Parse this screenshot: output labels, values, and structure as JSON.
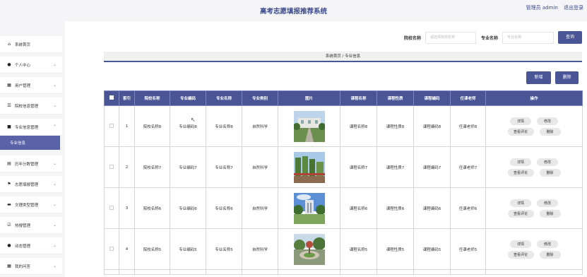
{
  "header": {
    "title": "高考志愿填报推荐系统",
    "user_label": "管理员 admin",
    "logout_label": "退出登录"
  },
  "sidebar": {
    "items": [
      {
        "label": "系统首页",
        "icon": "home-icon",
        "glyph": "⌂",
        "has_chevron": false
      },
      {
        "label": "个人中心",
        "icon": "user-icon",
        "glyph": "●",
        "has_chevron": true
      },
      {
        "label": "用户管理",
        "icon": "grid-icon",
        "glyph": "▦",
        "has_chevron": true
      },
      {
        "label": "院校信息管理",
        "icon": "sliders-icon",
        "glyph": "☰",
        "has_chevron": true
      },
      {
        "label": "专业信息管理",
        "icon": "lock-icon",
        "glyph": "■",
        "has_chevron": true,
        "expanded": true
      },
      {
        "label": "历年分数管理",
        "icon": "list-icon",
        "glyph": "▤",
        "has_chevron": true
      },
      {
        "label": "志愿填报管理",
        "icon": "flag-icon",
        "glyph": "⚑",
        "has_chevron": true
      },
      {
        "label": "文理类型管理",
        "icon": "printer-icon",
        "glyph": "▬",
        "has_chevron": true
      },
      {
        "label": "热搜管理",
        "icon": "checkbox-icon",
        "glyph": "☑",
        "has_chevron": true
      },
      {
        "label": "动态管理",
        "icon": "person-icon",
        "glyph": "●",
        "has_chevron": true
      },
      {
        "label": "我的问答",
        "icon": "grid-icon",
        "glyph": "▦",
        "has_chevron": true
      }
    ],
    "active_sub": "专业信息"
  },
  "search": {
    "school_label": "院校名称",
    "school_placeholder": "请选择院校名称",
    "major_label": "专业名称",
    "major_placeholder": "专业名称",
    "button": "查询"
  },
  "breadcrumb": "系统首页 / 专业信息",
  "actions": {
    "add": "新增",
    "delete": "删除"
  },
  "table": {
    "headers": [
      "索引",
      "院校名称",
      "专业编码",
      "专业名称",
      "专业类别",
      "图片",
      "课程名称",
      "课程性质",
      "课程编码",
      "任课老师",
      "操作"
    ],
    "rows": [
      {
        "index": "1",
        "school": "院校名称8",
        "code": "专业编码8",
        "name": "专业名称8",
        "category": "自然科学",
        "course": "课程名称8",
        "nature": "课程性质8",
        "course_code": "课程编码8",
        "teacher": "任课老师8"
      },
      {
        "index": "2",
        "school": "院校名称7",
        "code": "专业编码7",
        "name": "专业名称7",
        "category": "自然科学",
        "course": "课程名称7",
        "nature": "课程性质7",
        "course_code": "课程编码7",
        "teacher": "任课老师7"
      },
      {
        "index": "3",
        "school": "院校名称6",
        "code": "专业编码6",
        "name": "专业名称6",
        "category": "自然科学",
        "course": "课程名称6",
        "nature": "课程性质6",
        "course_code": "课程编码6",
        "teacher": "任课老师6"
      },
      {
        "index": "4",
        "school": "院校名称5",
        "code": "专业编码5",
        "name": "专业名称5",
        "category": "自然科学",
        "course": "课程名称5",
        "nature": "课程性质5",
        "course_code": "课程编码5",
        "teacher": "任课老师5"
      }
    ],
    "ops": {
      "detail": "详情",
      "edit": "修改",
      "comments": "查看评论",
      "delete": "删除"
    }
  },
  "colors": {
    "accent": "#4a5596",
    "sidebar_active": "#5b63a8",
    "header_bg": "#f5f5f7"
  }
}
